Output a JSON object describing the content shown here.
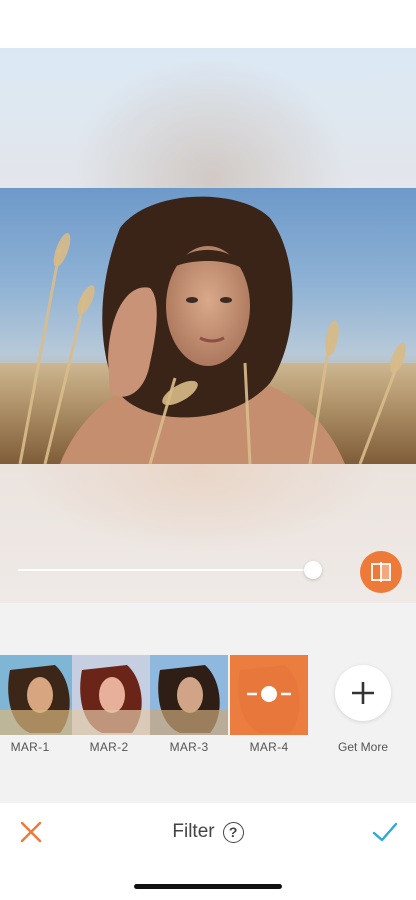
{
  "editor": {
    "tool_title": "Filter",
    "help_symbol": "?",
    "intensity_fraction": 1.0
  },
  "filters": [
    {
      "label": "MAR-1",
      "selected": false
    },
    {
      "label": "MAR-2",
      "selected": false
    },
    {
      "label": "MAR-3",
      "selected": false
    },
    {
      "label": "MAR-4",
      "selected": true
    }
  ],
  "get_more": {
    "label": "Get More"
  },
  "colors": {
    "accent": "#ee7a3a",
    "confirm": "#2aa8e0",
    "panel": "#f2f2f2"
  },
  "icons": {
    "cancel": "close-icon",
    "confirm": "checkmark-icon",
    "compare": "compare-icon",
    "add": "plus-icon",
    "adjust": "slider-adjust-icon"
  }
}
